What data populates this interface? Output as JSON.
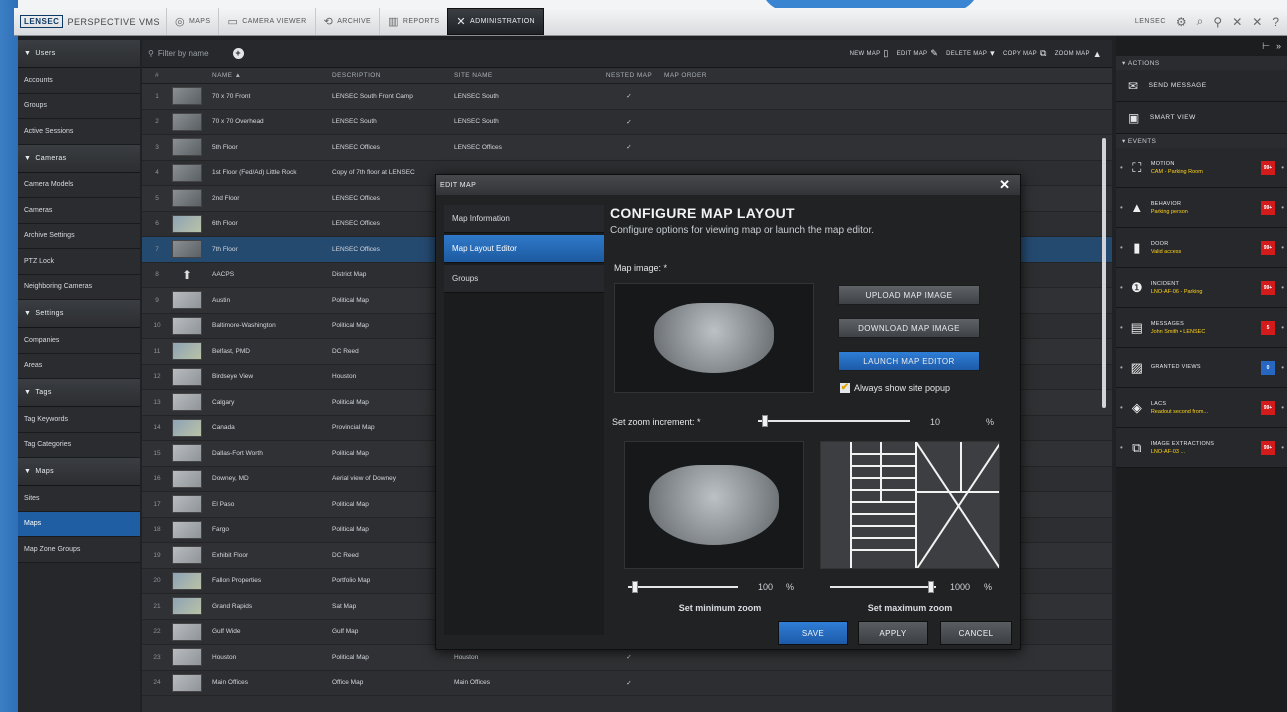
{
  "topbar": {
    "brand_logo": "LENSEC",
    "brand_name": "PERSPECTIVE VMS",
    "tabs": [
      "MAPS",
      "CAMERA VIEWER",
      "ARCHIVE",
      "REPORTS",
      "ADMINISTRATION"
    ],
    "user": "LENSEC"
  },
  "sidebar": {
    "sections": [
      {
        "title": "Users",
        "items": [
          "Accounts",
          "Groups",
          "Active Sessions"
        ]
      },
      {
        "title": "Cameras",
        "items": [
          "Camera Models",
          "Cameras",
          "Archive Settings",
          "PTZ Lock",
          "Neighboring Cameras"
        ]
      },
      {
        "title": "Settings",
        "items": [
          "Companies",
          "Areas"
        ]
      },
      {
        "title": "Tags",
        "items": [
          "Tag Keywords",
          "Tag Categories"
        ]
      },
      {
        "title": "Maps",
        "items": [
          "Sites",
          "Maps",
          "Map Zone Groups"
        ]
      }
    ],
    "active_item": "Maps"
  },
  "grid": {
    "filter_placeholder": "Filter by name",
    "toolbar_buttons": [
      "NEW MAP",
      "EDIT MAP",
      "DELETE MAP",
      "COPY MAP",
      "ZOOM MAP"
    ],
    "columns": [
      "#",
      "",
      "NAME",
      "DESCRIPTION",
      "SITE NAME",
      "NESTED MAP",
      "MAP ORDER"
    ],
    "rows": [
      {
        "num": "1",
        "thumb": "photo",
        "name": "70 x 70 Front",
        "desc": "LENSEC South Front Camp",
        "site": "LENSEC South",
        "nested": "✓"
      },
      {
        "num": "2",
        "thumb": "photo",
        "name": "70 x 70 Overhead",
        "desc": "LENSEC South",
        "site": "LENSEC South",
        "nested": "✓"
      },
      {
        "num": "3",
        "thumb": "photo",
        "name": "5th Floor",
        "desc": "LENSEC Offices",
        "site": "LENSEC Offices",
        "nested": "✓"
      },
      {
        "num": "4",
        "thumb": "photo",
        "name": "1st Floor (Fed/Ad) Little Rock",
        "desc": "Copy of 7th floor at LENSEC",
        "site": "",
        "nested": ""
      },
      {
        "num": "5",
        "thumb": "photo",
        "name": "2nd Floor",
        "desc": "LENSEC Offices",
        "site": "",
        "nested": ""
      },
      {
        "num": "6",
        "thumb": "color",
        "name": "6th Floor",
        "desc": "LENSEC Offices",
        "site": "",
        "nested": ""
      },
      {
        "num": "7",
        "thumb": "photo",
        "name": "7th Floor",
        "desc": "LENSEC Offices",
        "site": "",
        "nested": "",
        "selected": true
      },
      {
        "num": "8",
        "thumb": "pin",
        "name": "AACPS",
        "desc": "District Map",
        "site": "",
        "nested": ""
      },
      {
        "num": "9",
        "thumb": "map",
        "name": "Austin",
        "desc": "Political Map",
        "site": "",
        "nested": ""
      },
      {
        "num": "10",
        "thumb": "map",
        "name": "Baltimore-Washington",
        "desc": "Political Map",
        "site": "",
        "nested": ""
      },
      {
        "num": "11",
        "thumb": "color",
        "name": "Belfast, PMD",
        "desc": "DC Reed",
        "site": "",
        "nested": ""
      },
      {
        "num": "12",
        "thumb": "map",
        "name": "Birdseye View",
        "desc": "Houston",
        "site": "",
        "nested": ""
      },
      {
        "num": "13",
        "thumb": "map",
        "name": "Calgary",
        "desc": "Political Map",
        "site": "",
        "nested": ""
      },
      {
        "num": "14",
        "thumb": "color",
        "name": "Canada",
        "desc": "Provincial Map",
        "site": "",
        "nested": ""
      },
      {
        "num": "15",
        "thumb": "map",
        "name": "Dallas-Fort Worth",
        "desc": "Political Map",
        "site": "",
        "nested": ""
      },
      {
        "num": "16",
        "thumb": "map",
        "name": "Downey, MD",
        "desc": "Aerial view of Downey",
        "site": "",
        "nested": ""
      },
      {
        "num": "17",
        "thumb": "map",
        "name": "El Paso",
        "desc": "Political Map",
        "site": "",
        "nested": ""
      },
      {
        "num": "18",
        "thumb": "map",
        "name": "Fargo",
        "desc": "Political Map",
        "site": "",
        "nested": ""
      },
      {
        "num": "19",
        "thumb": "map",
        "name": "Exhibit Floor",
        "desc": "DC Reed",
        "site": "",
        "nested": ""
      },
      {
        "num": "20",
        "thumb": "color",
        "name": "Fallon Properties",
        "desc": "Portfolio Map",
        "site": "",
        "nested": ""
      },
      {
        "num": "21",
        "thumb": "color",
        "name": "Grand Rapids",
        "desc": "Sat Map",
        "site": "",
        "nested": ""
      },
      {
        "num": "22",
        "thumb": "map",
        "name": "Gulf Wide",
        "desc": "Gulf Map",
        "site": "Gulf of Mexico",
        "nested": "✓"
      },
      {
        "num": "23",
        "thumb": "map",
        "name": "Houston",
        "desc": "Political Map",
        "site": "Houston",
        "nested": "✓"
      },
      {
        "num": "24",
        "thumb": "map",
        "name": "Main Offices",
        "desc": "Office Map",
        "site": "Main Offices",
        "nested": "✓"
      }
    ]
  },
  "rpanel": {
    "actions_title": "ACTIONS",
    "actions": [
      {
        "label": "SEND MESSAGE",
        "icon": "mail-icon"
      },
      {
        "label": "SMART VIEW",
        "icon": "monitor-icon"
      }
    ],
    "events_title": "EVENTS",
    "events": [
      {
        "title": "MOTION",
        "sub": "CAM - Parking Room",
        "badge": "99+",
        "icon": "motion-icon"
      },
      {
        "title": "BEHAVIOR",
        "sub": "Parking person",
        "badge": "99+",
        "icon": "warning-icon"
      },
      {
        "title": "DOOR",
        "sub": "Valid access",
        "badge": "99+",
        "icon": "door-icon"
      },
      {
        "title": "INCIDENT",
        "sub": "LNO-AF-06 - Parking",
        "badge": "99+",
        "icon": "alert-icon"
      },
      {
        "title": "MESSAGES",
        "sub": "John Smith • LENSEC",
        "badge": "5",
        "icon": "message-icon"
      },
      {
        "title": "GRANTED VIEWS",
        "sub": "",
        "badge": "0",
        "badge_color": "blue",
        "icon": "view-icon"
      },
      {
        "title": "LACS",
        "sub": "Readout second from...",
        "badge": "99+",
        "icon": "tag-icon"
      },
      {
        "title": "IMAGE EXTRACTIONS",
        "sub": "LNO-AF-03 ...",
        "badge": "99+",
        "icon": "image-icon"
      }
    ]
  },
  "modal": {
    "title": "EDIT MAP",
    "nav": [
      "Map Information",
      "Map Layout Editor",
      "Groups"
    ],
    "active_nav": "Map Layout Editor",
    "heading": "CONFIGURE MAP LAYOUT",
    "subheading": "Configure options for viewing map or launch the map editor.",
    "map_image_label": "Map image: *",
    "upload_label": "UPLOAD MAP IMAGE",
    "download_label": "DOWNLOAD MAP IMAGE",
    "launch_label": "LAUNCH MAP EDITOR",
    "always_popup_label": "Always show site popup",
    "zoom_increment_label": "Set zoom increment: *",
    "zoom_increment_value": "10",
    "zoom_increment_unit": "%",
    "min_zoom_value": "100",
    "max_zoom_value": "1000",
    "min_zoom_label": "Set minimum zoom",
    "max_zoom_label": "Set maximum zoom",
    "save_label": "SAVE",
    "apply_label": "APPLY",
    "cancel_label": "CANCEL",
    "colors": {
      "primary": "#2f7ed6",
      "close": "#ffffff"
    }
  }
}
